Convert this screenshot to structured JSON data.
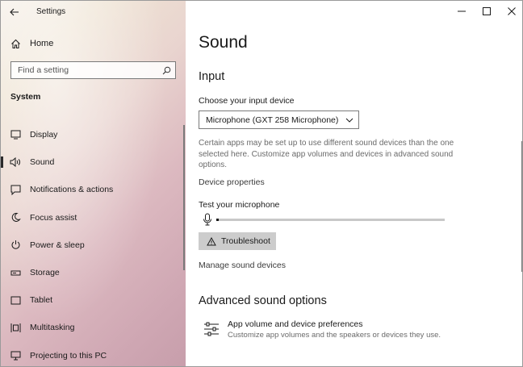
{
  "window": {
    "title": "Settings",
    "minimize_glyph": "—",
    "maximize_glyph": "☐",
    "close_glyph": "✕"
  },
  "sidebar": {
    "home_label": "Home",
    "search_placeholder": "Find a setting",
    "section_label": "System",
    "items": [
      {
        "label": "Display",
        "icon": "display-icon"
      },
      {
        "label": "Sound",
        "icon": "speaker-icon",
        "active": true
      },
      {
        "label": "Notifications & actions",
        "icon": "notification-icon"
      },
      {
        "label": "Focus assist",
        "icon": "moon-icon"
      },
      {
        "label": "Power & sleep",
        "icon": "power-icon"
      },
      {
        "label": "Storage",
        "icon": "storage-icon"
      },
      {
        "label": "Tablet",
        "icon": "tablet-icon"
      },
      {
        "label": "Multitasking",
        "icon": "multitasking-icon"
      },
      {
        "label": "Projecting to this PC",
        "icon": "projecting-icon"
      }
    ]
  },
  "main": {
    "title": "Sound",
    "input_heading": "Input",
    "choose_label": "Choose your input device",
    "device_value": "Microphone (GXT 258 Microphone)",
    "description": "Certain apps may be set up to use different sound devices than the one selected here. Customize app volumes and devices in advanced sound options.",
    "device_properties_link": "Device properties",
    "test_label": "Test your microphone",
    "mic_level": 0.01,
    "troubleshoot_label": "Troubleshoot",
    "manage_link": "Manage sound devices",
    "advanced_heading": "Advanced sound options",
    "app_volume_title": "App volume and device preferences",
    "app_volume_desc": "Customize app volumes and the speakers or devices they use."
  }
}
